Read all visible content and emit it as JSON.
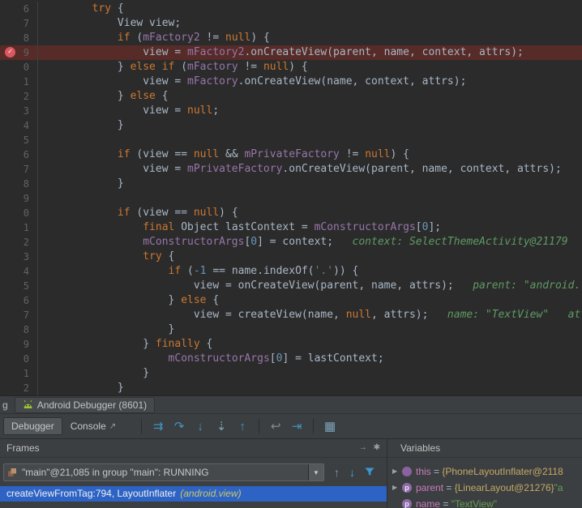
{
  "window": {
    "tool_label_fragment": "g",
    "session_tab": "Android Debugger (8601)"
  },
  "tabs": {
    "debugger": "Debugger",
    "console": "Console",
    "console_icon": "↗"
  },
  "toolbar": {
    "icons": [
      {
        "sep": true
      },
      {
        "name": "show-execution-point-icon",
        "glyph": "⇉",
        "cls": "teal"
      },
      {
        "name": "step-over-icon",
        "glyph": "↷",
        "cls": "teal"
      },
      {
        "name": "step-into-icon",
        "glyph": "↓",
        "cls": "teal"
      },
      {
        "name": "force-step-into-icon",
        "glyph": "⇣",
        "cls": "muted"
      },
      {
        "name": "step-out-icon",
        "glyph": "↑",
        "cls": "teal"
      },
      {
        "sep": true
      },
      {
        "name": "drop-frame-icon",
        "glyph": "↩",
        "cls": "gray"
      },
      {
        "name": "run-to-cursor-icon",
        "glyph": "⇥",
        "cls": "teal"
      },
      {
        "sep": true
      },
      {
        "name": "view-breakpoints-grid-icon",
        "glyph": "▦",
        "cls": "muted"
      }
    ]
  },
  "frames": {
    "header": "Frames",
    "header_icons": [
      {
        "name": "restore-layout-icon",
        "glyph": "→"
      },
      {
        "name": "pin-icon",
        "glyph": "✱"
      }
    ],
    "thread": "\"main\"@21,085 in group \"main\": RUNNING",
    "dropdown_glyph": "▼",
    "up_glyph": "↑",
    "down_glyph": "↓",
    "selected_frame": {
      "main": "createViewFromTag:794, LayoutInflater",
      "pkg": "(android.view)"
    }
  },
  "variables": {
    "header": "Variables",
    "rows": [
      {
        "expand": true,
        "icon": "t",
        "name": "this",
        "obj": "{PhoneLayoutInflater@2118",
        "str": ""
      },
      {
        "expand": true,
        "icon": "p",
        "name": "parent",
        "obj": "{LinearLayout@21276} ",
        "str": "\"a"
      },
      {
        "expand": false,
        "icon": "p",
        "name": "name",
        "obj": "",
        "str": "\"TextView\""
      }
    ]
  },
  "editor": {
    "breakpoint_index": 3,
    "breakpoint_glyph": "✓",
    "lines": [
      {
        "n": "6",
        "seg": [
          [
            "p",
            "        "
          ],
          [
            "k",
            "try"
          ],
          [
            "p",
            " {"
          ]
        ]
      },
      {
        "n": "7",
        "seg": [
          [
            "p",
            "            View view;"
          ]
        ]
      },
      {
        "n": "8",
        "seg": [
          [
            "p",
            "            "
          ],
          [
            "k",
            "if"
          ],
          [
            "p",
            " ("
          ],
          [
            "f",
            "mFactory2"
          ],
          [
            "p",
            " != "
          ],
          [
            "k",
            "null"
          ],
          [
            "p",
            ") {"
          ]
        ]
      },
      {
        "n": "9",
        "seg": [
          [
            "p",
            "                view = "
          ],
          [
            "f",
            "mFactory2"
          ],
          [
            "p",
            ".onCreateView(parent, name, context, attrs);"
          ]
        ]
      },
      {
        "n": "0",
        "seg": [
          [
            "p",
            "            } "
          ],
          [
            "k",
            "else"
          ],
          [
            "p",
            " "
          ],
          [
            "k",
            "if"
          ],
          [
            "p",
            " ("
          ],
          [
            "f",
            "mFactory"
          ],
          [
            "p",
            " != "
          ],
          [
            "k",
            "null"
          ],
          [
            "p",
            ") {"
          ]
        ]
      },
      {
        "n": "1",
        "seg": [
          [
            "p",
            "                view = "
          ],
          [
            "f",
            "mFactory"
          ],
          [
            "p",
            ".onCreateView(name, context, attrs);"
          ]
        ]
      },
      {
        "n": "2",
        "seg": [
          [
            "p",
            "            } "
          ],
          [
            "k",
            "else"
          ],
          [
            "p",
            " {"
          ]
        ]
      },
      {
        "n": "3",
        "seg": [
          [
            "p",
            "                view = "
          ],
          [
            "k",
            "null"
          ],
          [
            "p",
            ";"
          ]
        ]
      },
      {
        "n": "4",
        "seg": [
          [
            "p",
            "            }"
          ]
        ]
      },
      {
        "n": "5",
        "seg": []
      },
      {
        "n": "6",
        "seg": [
          [
            "p",
            "            "
          ],
          [
            "k",
            "if"
          ],
          [
            "p",
            " (view == "
          ],
          [
            "k",
            "null"
          ],
          [
            "p",
            " && "
          ],
          [
            "f",
            "mPrivateFactory"
          ],
          [
            "p",
            " != "
          ],
          [
            "k",
            "null"
          ],
          [
            "p",
            ") {"
          ]
        ]
      },
      {
        "n": "7",
        "seg": [
          [
            "p",
            "                view = "
          ],
          [
            "f",
            "mPrivateFactory"
          ],
          [
            "p",
            ".onCreateView(parent, name, context, attrs);"
          ]
        ]
      },
      {
        "n": "8",
        "seg": [
          [
            "p",
            "            }"
          ]
        ]
      },
      {
        "n": "9",
        "seg": []
      },
      {
        "n": "0",
        "seg": [
          [
            "p",
            "            "
          ],
          [
            "k",
            "if"
          ],
          [
            "p",
            " (view == "
          ],
          [
            "k",
            "null"
          ],
          [
            "p",
            ") {"
          ]
        ]
      },
      {
        "n": "1",
        "seg": [
          [
            "p",
            "                "
          ],
          [
            "k",
            "final"
          ],
          [
            "p",
            " Object lastContext = "
          ],
          [
            "f",
            "mConstructorArgs"
          ],
          [
            "p",
            "["
          ],
          [
            "n",
            "0"
          ],
          [
            "p",
            "];"
          ]
        ]
      },
      {
        "n": "2",
        "seg": [
          [
            "p",
            "                "
          ],
          [
            "f",
            "mConstructorArgs"
          ],
          [
            "p",
            "["
          ],
          [
            "n",
            "0"
          ],
          [
            "p",
            "] = context;"
          ],
          [
            "h",
            "   context: SelectThemeActivity@21179"
          ]
        ]
      },
      {
        "n": "3",
        "seg": [
          [
            "p",
            "                "
          ],
          [
            "k",
            "try"
          ],
          [
            "p",
            " {"
          ]
        ]
      },
      {
        "n": "4",
        "seg": [
          [
            "p",
            "                    "
          ],
          [
            "k",
            "if"
          ],
          [
            "p",
            " ("
          ],
          [
            "n",
            "-1"
          ],
          [
            "p",
            " == name.indexOf("
          ],
          [
            "s",
            "'.'"
          ],
          [
            "p",
            ")) {"
          ]
        ]
      },
      {
        "n": "5",
        "seg": [
          [
            "p",
            "                        view = onCreateView(parent, name, attrs);"
          ],
          [
            "h",
            "   parent: \"android."
          ]
        ]
      },
      {
        "n": "6",
        "seg": [
          [
            "p",
            "                    } "
          ],
          [
            "k",
            "else"
          ],
          [
            "p",
            " {"
          ]
        ]
      },
      {
        "n": "7",
        "seg": [
          [
            "p",
            "                        view = createView(name, "
          ],
          [
            "k",
            "null"
          ],
          [
            "p",
            ", attrs);"
          ],
          [
            "h",
            "   name: \"TextView\"   att"
          ]
        ]
      },
      {
        "n": "8",
        "seg": [
          [
            "p",
            "                    }"
          ]
        ]
      },
      {
        "n": "9",
        "seg": [
          [
            "p",
            "                } "
          ],
          [
            "k",
            "finally"
          ],
          [
            "p",
            " {"
          ]
        ]
      },
      {
        "n": "0",
        "seg": [
          [
            "p",
            "                    "
          ],
          [
            "f",
            "mConstructorArgs"
          ],
          [
            "p",
            "["
          ],
          [
            "n",
            "0"
          ],
          [
            "p",
            "] = lastContext;"
          ]
        ]
      },
      {
        "n": "1",
        "seg": [
          [
            "p",
            "                }"
          ]
        ]
      },
      {
        "n": "2",
        "seg": [
          [
            "p",
            "            }"
          ]
        ]
      }
    ]
  },
  "colors": {
    "editor_bg": "#2b2b2b",
    "breakpoint_line_bg": "#572b28",
    "breakpoint_red": "#db5860",
    "keyword": "#cc7832",
    "field": "#9876aa",
    "string": "#6a8759",
    "number": "#6897bb",
    "debug_hint": "#5f9a63",
    "selection_blue": "#2d63c5",
    "panel_bg": "#3c3f41"
  }
}
